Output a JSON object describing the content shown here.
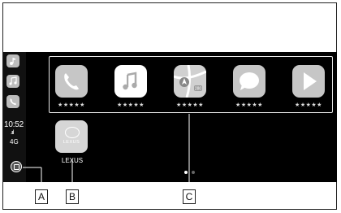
{
  "sidebar": {
    "icons": [
      "music-app-icon",
      "music-note-icon",
      "phone-icon"
    ],
    "time": "10:52",
    "signal": ".ııl",
    "network": "4G"
  },
  "dock": {
    "apps": [
      {
        "name": "phone-app",
        "label": "★★★★★"
      },
      {
        "name": "music-app",
        "label": "★★★★★"
      },
      {
        "name": "maps-app",
        "label": "★★★★★"
      },
      {
        "name": "messages-app",
        "label": "★★★★★"
      },
      {
        "name": "play-app",
        "label": "★★★★★"
      }
    ]
  },
  "lexus_app": {
    "icon_text": "LEXUS",
    "label": "LEXUS"
  },
  "callouts": {
    "a": "A",
    "b": "B",
    "c": "C"
  },
  "colors": {
    "screen": "#000000",
    "app_tile": "#c6c6c6",
    "dock_outline": "#e8e8e8"
  }
}
